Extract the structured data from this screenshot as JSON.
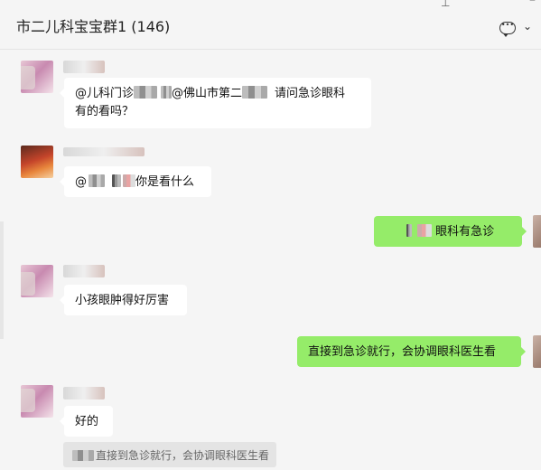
{
  "header": {
    "title": "市二儿科宝宝群1 (146)",
    "icons": [
      "pin-icon",
      "minimize-icon",
      "chat-more-icon",
      "chevron-down-icon"
    ]
  },
  "messages": [
    {
      "side": "left",
      "avatar": "pink-avatar",
      "text_parts": [
        "@儿科门诊",
        "@佛山市第二",
        "请问急诊眼科",
        "有的看吗？"
      ]
    },
    {
      "side": "left",
      "avatar": "red-avatar",
      "text_parts": [
        "@",
        "你是看什么"
      ]
    },
    {
      "side": "right",
      "avatar": "self-avatar",
      "text": "眼科有急诊"
    },
    {
      "side": "left",
      "avatar": "pink-avatar",
      "text": "小孩眼肿得好厉害"
    },
    {
      "side": "right",
      "avatar": "self-avatar",
      "text": "直接到急诊就行，会协调眼科医生看"
    },
    {
      "side": "left",
      "avatar": "pink-avatar",
      "text": "好的"
    }
  ],
  "quote": {
    "text": "直接到急诊就行，会协调眼科医生看"
  },
  "colors": {
    "bubble_self": "#95ec69",
    "bubble_other": "#ffffff",
    "background": "#f5f5f5"
  }
}
